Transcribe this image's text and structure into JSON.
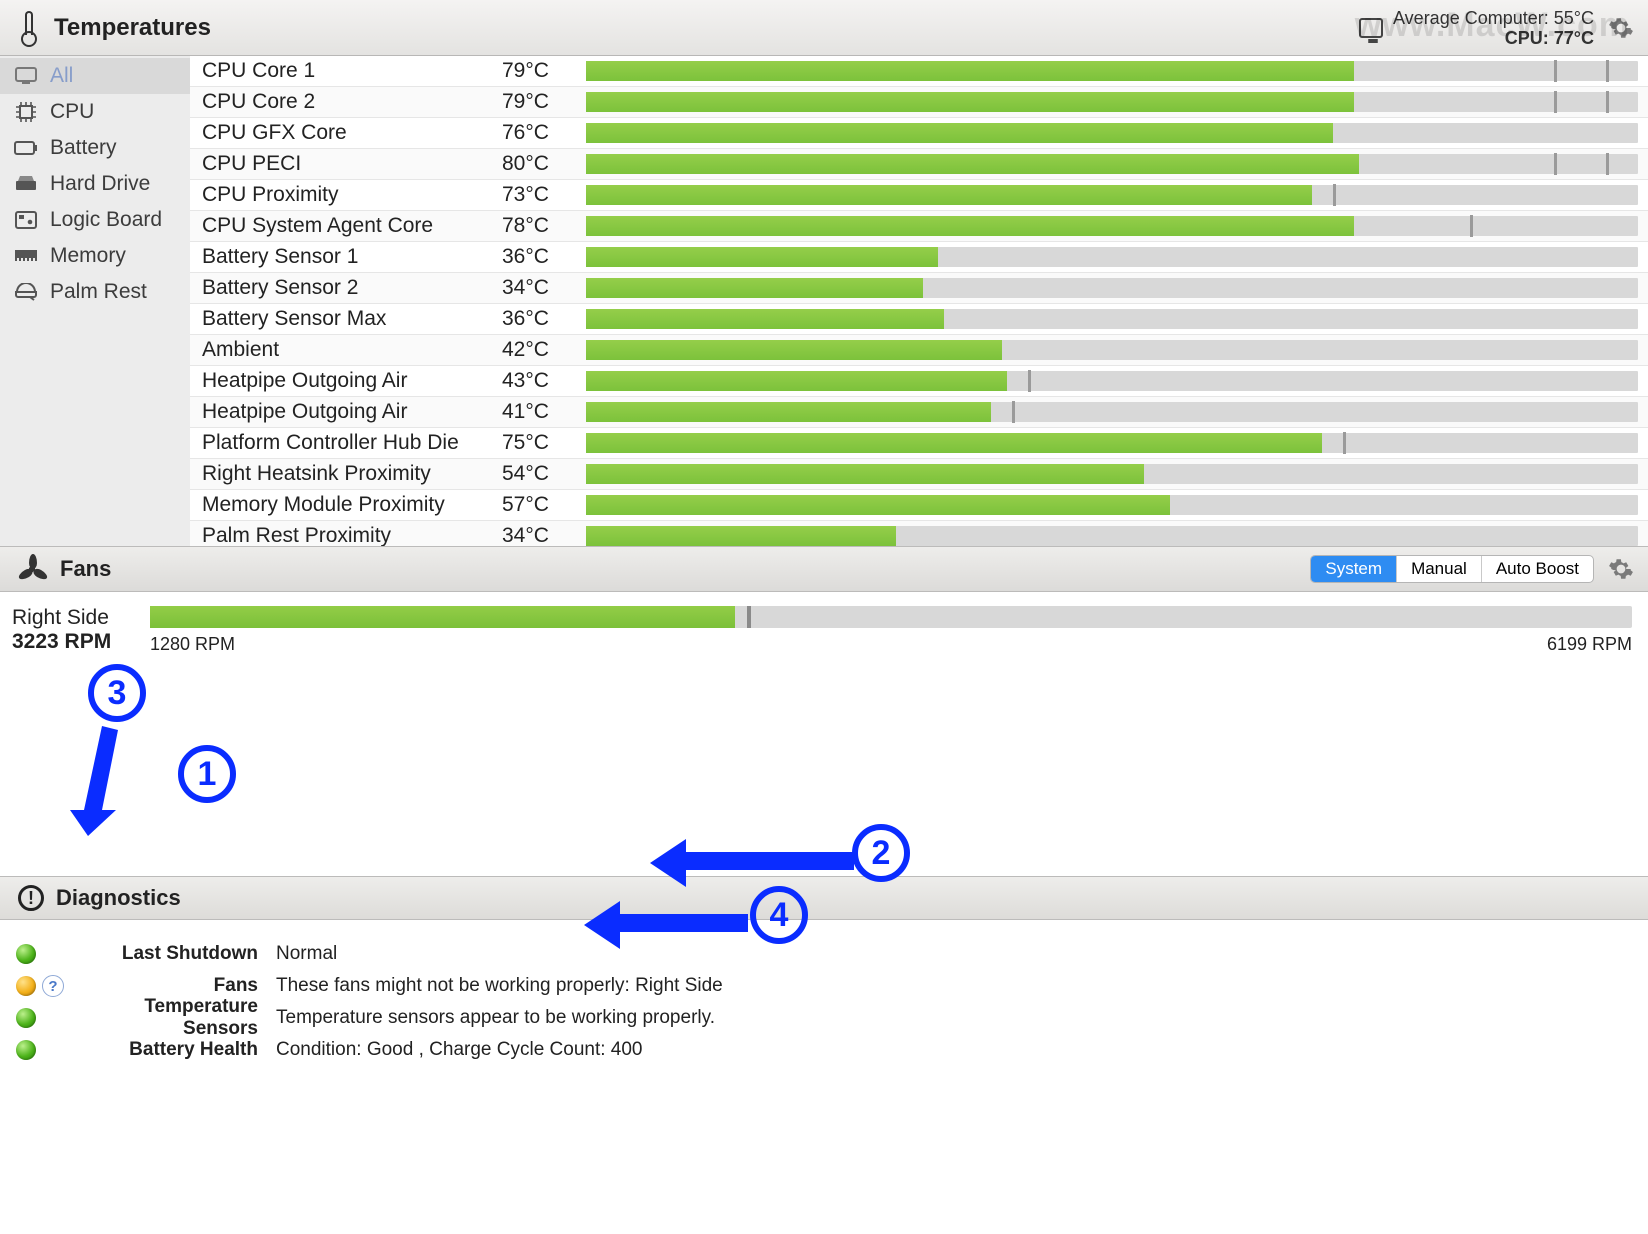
{
  "watermark": "www.MacW.com",
  "header": {
    "title": "Temperatures",
    "summary": {
      "line1_label": "Average Computer:",
      "line1_value": "55°C",
      "line2_label": "CPU:",
      "line2_value": "77°C"
    }
  },
  "sidebar": {
    "items": [
      {
        "label": "All",
        "icon": "monitor-icon",
        "selected": true
      },
      {
        "label": "CPU",
        "icon": "cpu-icon"
      },
      {
        "label": "Battery",
        "icon": "battery-icon"
      },
      {
        "label": "Hard Drive",
        "icon": "harddrive-icon"
      },
      {
        "label": "Logic Board",
        "icon": "logicboard-icon"
      },
      {
        "label": "Memory",
        "icon": "memory-icon"
      },
      {
        "label": "Palm Rest",
        "icon": "palmrest-icon"
      }
    ]
  },
  "temperatures": {
    "max_scale": 105,
    "rows": [
      {
        "name": "CPU Core 1",
        "value": "79°C",
        "fill": 73,
        "marks": [
          92,
          97
        ]
      },
      {
        "name": "CPU Core 2",
        "value": "79°C",
        "fill": 73,
        "marks": [
          92,
          97
        ]
      },
      {
        "name": "CPU GFX Core",
        "value": "76°C",
        "fill": 71,
        "marks": []
      },
      {
        "name": "CPU PECI",
        "value": "80°C",
        "fill": 73.5,
        "marks": [
          92,
          97
        ]
      },
      {
        "name": "CPU Proximity",
        "value": "73°C",
        "fill": 69,
        "marks": [
          71
        ]
      },
      {
        "name": "CPU System Agent Core",
        "value": "78°C",
        "fill": 73,
        "marks": [
          84
        ]
      },
      {
        "name": "Battery Sensor 1",
        "value": "36°C",
        "fill": 33.5,
        "marks": []
      },
      {
        "name": "Battery Sensor 2",
        "value": "34°C",
        "fill": 32,
        "marks": []
      },
      {
        "name": "Battery Sensor Max",
        "value": "36°C",
        "fill": 34,
        "marks": []
      },
      {
        "name": "Ambient",
        "value": "42°C",
        "fill": 39.5,
        "marks": []
      },
      {
        "name": "Heatpipe Outgoing Air",
        "value": "43°C",
        "fill": 40,
        "marks": [
          42
        ]
      },
      {
        "name": "Heatpipe Outgoing Air",
        "value": "41°C",
        "fill": 38.5,
        "marks": [
          40.5
        ]
      },
      {
        "name": "Platform Controller Hub Die",
        "value": "75°C",
        "fill": 70,
        "marks": [
          72
        ]
      },
      {
        "name": "Right Heatsink Proximity",
        "value": "54°C",
        "fill": 53,
        "marks": []
      },
      {
        "name": "Memory Module Proximity",
        "value": "57°C",
        "fill": 55.5,
        "marks": []
      },
      {
        "name": "Palm Rest Proximity",
        "value": "34°C",
        "fill": 29.5,
        "marks": []
      }
    ]
  },
  "fans": {
    "title": "Fans",
    "modes": [
      "System",
      "Manual",
      "Auto Boost"
    ],
    "active_mode": 0,
    "fan": {
      "name": "Right Side",
      "rpm_text": "3223 RPM",
      "min": 1280,
      "min_text": "1280 RPM",
      "max": 6199,
      "max_text": "6199 RPM",
      "current": 3223,
      "fill_percent": 39.5,
      "mark_percent": 40.3
    }
  },
  "diagnostics": {
    "title": "Diagnostics",
    "rows": [
      {
        "status": "green",
        "label": "Last Shutdown",
        "value": "Normal",
        "help": false
      },
      {
        "status": "yellow",
        "label": "Fans",
        "value": "These fans might not be working properly: Right Side",
        "help": true
      },
      {
        "status": "green",
        "label": "Temperature Sensors",
        "value": "Temperature sensors appear to be working properly.",
        "help": false
      },
      {
        "status": "green",
        "label": "Battery Health",
        "value": "Condition: Good , Charge Cycle Count: 400",
        "help": false
      }
    ]
  },
  "annotations": {
    "n1": "1",
    "n2": "2",
    "n3": "3",
    "n4": "4"
  },
  "chart_data": {
    "type": "bar",
    "note": "Horizontal temperature bars; fill percentages relative to chart width (approx).",
    "categories": [
      "CPU Core 1",
      "CPU Core 2",
      "CPU GFX Core",
      "CPU PECI",
      "CPU Proximity",
      "CPU System Agent Core",
      "Battery Sensor 1",
      "Battery Sensor 2",
      "Battery Sensor Max",
      "Ambient",
      "Heatpipe Outgoing Air (1)",
      "Heatpipe Outgoing Air (2)",
      "Platform Controller Hub Die",
      "Right Heatsink Proximity",
      "Memory Module Proximity",
      "Palm Rest Proximity"
    ],
    "values_celsius": [
      79,
      79,
      76,
      80,
      73,
      78,
      36,
      34,
      36,
      42,
      43,
      41,
      75,
      54,
      57,
      34
    ],
    "fill_percent": [
      73,
      73,
      71,
      73.5,
      69,
      73,
      33.5,
      32,
      34,
      39.5,
      40,
      38.5,
      70,
      53,
      55.5,
      29.5
    ]
  }
}
